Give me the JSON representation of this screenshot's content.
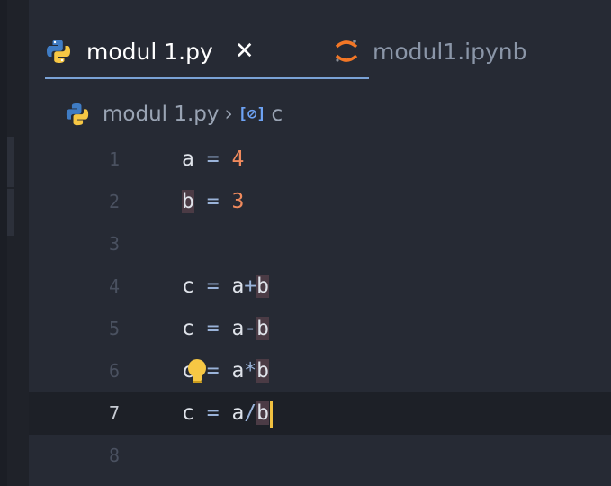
{
  "tabs": [
    {
      "label": "modul 1.py",
      "icon": "python-icon",
      "active": true,
      "close": "✕"
    },
    {
      "label": "modul1.ipynb",
      "icon": "jupyter-icon",
      "active": false
    }
  ],
  "breadcrumb": {
    "file": "modul 1.py",
    "separator": "›",
    "symbol_icon": "[⊘]",
    "symbol": "c"
  },
  "editor": {
    "current_line": 7,
    "lines": [
      {
        "n": "1",
        "var": "a",
        "eq": "=",
        "rhs": "4"
      },
      {
        "n": "2",
        "var": "b",
        "eq": "=",
        "rhs": "3"
      },
      {
        "n": "3"
      },
      {
        "n": "4",
        "var": "c",
        "eq": "=",
        "a": "a",
        "op": "+",
        "b": "b"
      },
      {
        "n": "5",
        "var": "c",
        "eq": "=",
        "a": "a",
        "op": "-",
        "b": "b"
      },
      {
        "n": "6",
        "var": "c",
        "eq": "=",
        "a": "a",
        "op": "*",
        "b": "b"
      },
      {
        "n": "7",
        "var": "c",
        "eq": "=",
        "a": "a",
        "op": "/",
        "b": "b"
      },
      {
        "n": "8"
      }
    ]
  },
  "colors": {
    "background": "#262a34",
    "number": "#f08a5d",
    "cursor": "#f0c040",
    "accent": "#7aa2d6"
  }
}
